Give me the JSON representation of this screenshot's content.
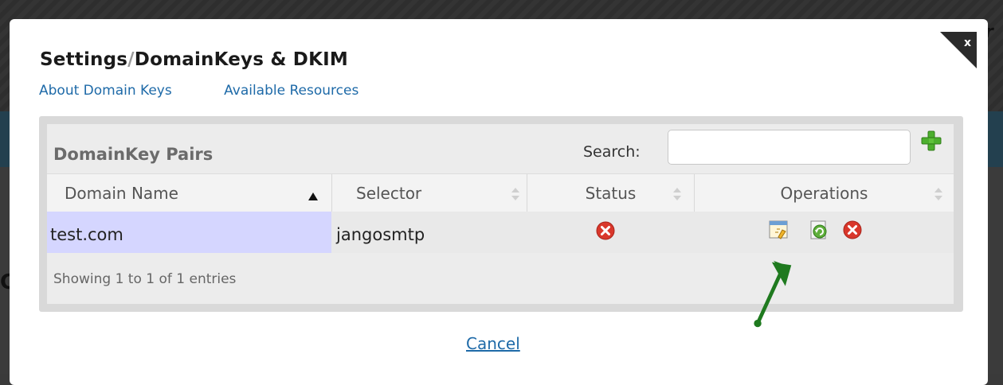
{
  "modal": {
    "title_part1": "Settings",
    "title_sep": "/",
    "title_part2": "DomainKeys & DKIM",
    "links": [
      "About Domain Keys",
      "Available Resources"
    ],
    "cancel_label": "Cancel"
  },
  "panel": {
    "title": "DomainKey Pairs",
    "search_label": "Search:",
    "search_value": "",
    "columns": [
      "Domain Name",
      "Selector",
      "Status",
      "Operations"
    ],
    "rows": [
      {
        "domain": "test.com",
        "selector": "jangosmtp",
        "status": "error"
      }
    ],
    "info": "Showing 1 to 1 of 1 entries"
  },
  "colors": {
    "link": "#1e6aa8",
    "highlight_cell": "#d5d6ff",
    "status_error": "#d9372b",
    "add_green": "#4caf2e",
    "arrow_green": "#1f7a1f"
  },
  "icons": {
    "close": "close-icon",
    "add": "plus-icon",
    "sort": "sort-icon",
    "status": "error-circle-icon",
    "edit": "edit-key-icon",
    "refresh": "refresh-icon",
    "delete": "delete-icon"
  }
}
